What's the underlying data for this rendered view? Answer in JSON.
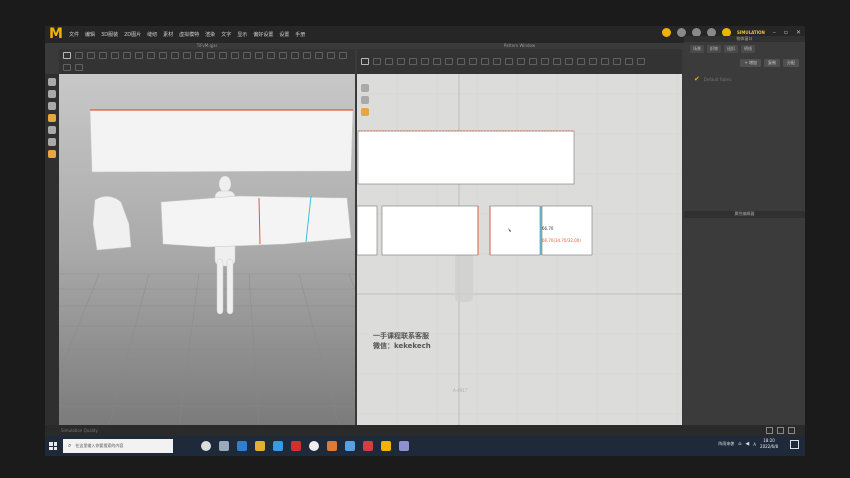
{
  "app": {
    "logo": "M",
    "menu": [
      "文件",
      "编辑",
      "3D服装",
      "2D图片",
      "缝纫",
      "素材",
      "虚拟模特",
      "渲染",
      "文字",
      "显示",
      "偏好设置",
      "设置",
      "手册"
    ],
    "status_label": "SIMULATION"
  },
  "panels": {
    "view3d_title": "TiFvM.qjar",
    "view2d_title": "Pattern Window",
    "right_title": "物体窗口",
    "right_tabs": [
      "场景",
      "织物",
      "纽扣",
      "明线"
    ],
    "right_buttons": [
      "+ 增加",
      "复制",
      "分配"
    ],
    "right_item": "Default Fabric",
    "right_title2": "属性编辑器"
  },
  "pattern": {
    "measure1": "66.70",
    "measure2": "66.70(34.70/32.00)",
    "grid_label": "A-4917"
  },
  "overlay": {
    "line1": "一手课程联系客服",
    "line2": "微信：kekekech"
  },
  "status_left": "Simulation Quality",
  "taskbar": {
    "search_placeholder": "在这里输入你要搜索的内容",
    "tray_text": "阵雨来袭",
    "time": "18:20",
    "date": "2022/6/8",
    "ime": "A"
  },
  "colors": {
    "accent": "#f0b400",
    "seam_red": "#e05a3a",
    "seam_cyan": "#3bbfe0"
  }
}
